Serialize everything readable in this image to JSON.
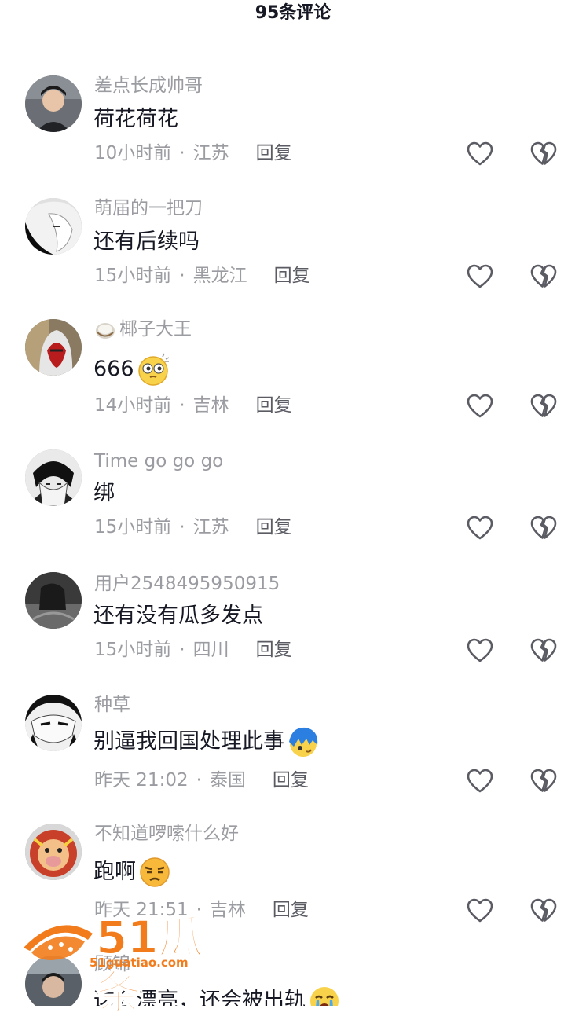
{
  "header": {
    "title": "95条评论"
  },
  "comments": [
    {
      "username": "差点长成帅哥",
      "text": "荷花荷花",
      "time": "10小时前",
      "location": "江苏",
      "reply": "回复"
    },
    {
      "username": "萌届的一把刀",
      "text": "还有后续吗",
      "time": "15小时前",
      "location": "黑龙江",
      "reply": "回复"
    },
    {
      "username": "椰子大王",
      "username_emoji": "coconut-icon",
      "text": "666",
      "text_emoji": "dizzy-face-emoji",
      "time": "14小时前",
      "location": "吉林",
      "reply": "回复"
    },
    {
      "username": "Time go go go",
      "text": "绑",
      "time": "15小时前",
      "location": "江苏",
      "reply": "回复"
    },
    {
      "username": "用户2548495950915",
      "text": "还有没有瓜多发点",
      "time": "15小时前",
      "location": "四川",
      "reply": "回复"
    },
    {
      "username": "种草",
      "text": "别逼我回国处理此事",
      "text_emoji": "blue-hair-emoji",
      "time": "昨天 21:02",
      "location": "泰国",
      "reply": "回复"
    },
    {
      "username": "不知道啰嗦什么好",
      "text": "跑啊",
      "text_emoji": "unamused-face-emoji",
      "time": "昨天 21:51",
      "location": "吉林",
      "reply": "回复"
    },
    {
      "username": "顾锦",
      "text": "这么漂亮，还会被出轨",
      "text_emoji": "crying-face-emoji",
      "time": "",
      "location": "",
      "reply": ""
    }
  ],
  "watermark": {
    "brand": "51瓜条",
    "url": "51guatiao.com"
  },
  "colors": {
    "secondary_text": "#9b9ca1",
    "primary_text": "#161823",
    "icon": "#5a5b63",
    "watermark": "#f27c1b"
  }
}
